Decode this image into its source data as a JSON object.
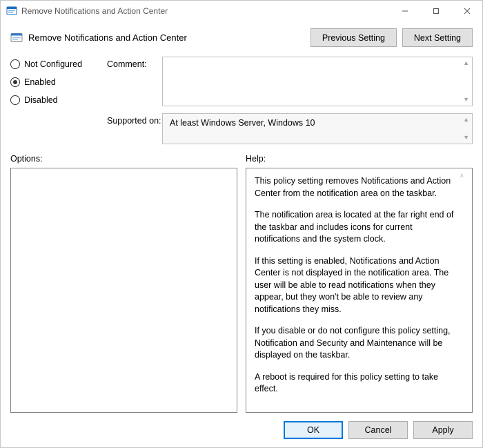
{
  "window": {
    "title": "Remove Notifications and Action Center"
  },
  "header": {
    "policy_title": "Remove Notifications and Action Center",
    "previous_label": "Previous Setting",
    "next_label": "Next Setting"
  },
  "state": {
    "not_configured_label": "Not Configured",
    "enabled_label": "Enabled",
    "disabled_label": "Disabled",
    "selected": "Enabled"
  },
  "fields": {
    "comment_label": "Comment:",
    "comment_value": "",
    "supported_label": "Supported on:",
    "supported_value": "At least Windows Server, Windows 10"
  },
  "sections": {
    "options_label": "Options:",
    "help_label": "Help:"
  },
  "help": {
    "p1": "This policy setting removes Notifications and Action Center from the notification area on the taskbar.",
    "p2": "The notification area is located at the far right end of the taskbar and includes icons for current notifications and the system clock.",
    "p3": "If this setting is enabled, Notifications and Action Center is not displayed in the notification area. The user will be able to read notifications when they appear, but they won't be able to review any notifications they miss.",
    "p4": "If you disable or do not configure this policy setting, Notification and Security and Maintenance will be displayed on the taskbar.",
    "p5": "A reboot is required for this policy setting to take effect."
  },
  "buttons": {
    "ok": "OK",
    "cancel": "Cancel",
    "apply": "Apply"
  }
}
